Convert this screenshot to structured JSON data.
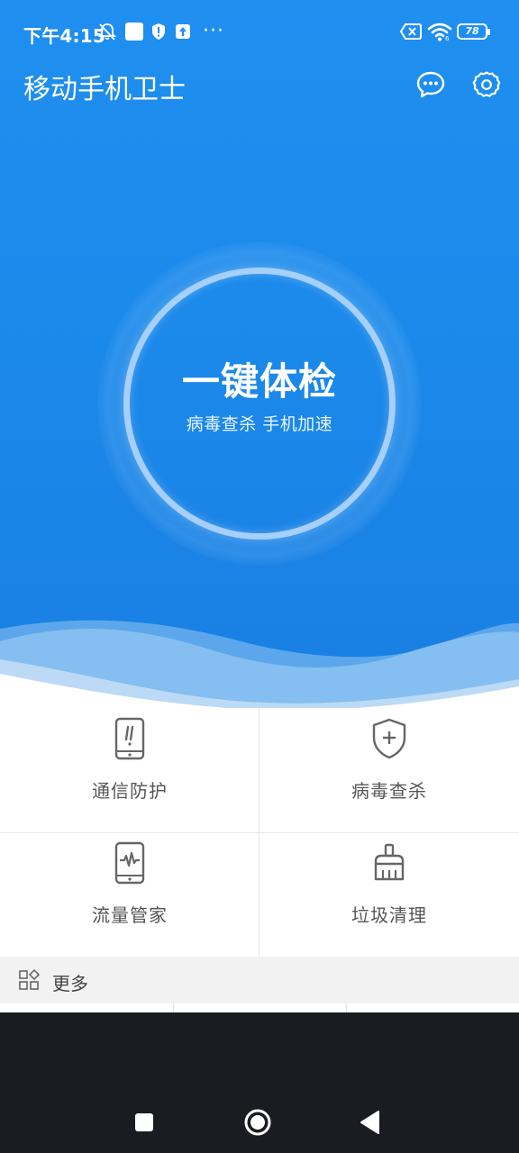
{
  "status_bar": {
    "time": "下午4:15",
    "more": "···",
    "battery": "78"
  },
  "header": {
    "title": "移动手机卫士",
    "message_icon": "message-bubble-icon",
    "settings_icon": "gear-icon"
  },
  "check": {
    "title": "一键体检",
    "subtitle": "病毒查杀  手机加速"
  },
  "features": [
    {
      "label": "通信防护",
      "icon": "phone-alert-icon"
    },
    {
      "label": "病毒查杀",
      "icon": "shield-plus-icon"
    },
    {
      "label": "流量管家",
      "icon": "phone-pulse-icon"
    },
    {
      "label": "垃圾清理",
      "icon": "broom-icon"
    }
  ],
  "more": {
    "label": "更多",
    "icon": "apps-grid-icon"
  },
  "colors": {
    "brand_blue": "#1f8ff0",
    "nav_bg": "#1b1c22"
  }
}
